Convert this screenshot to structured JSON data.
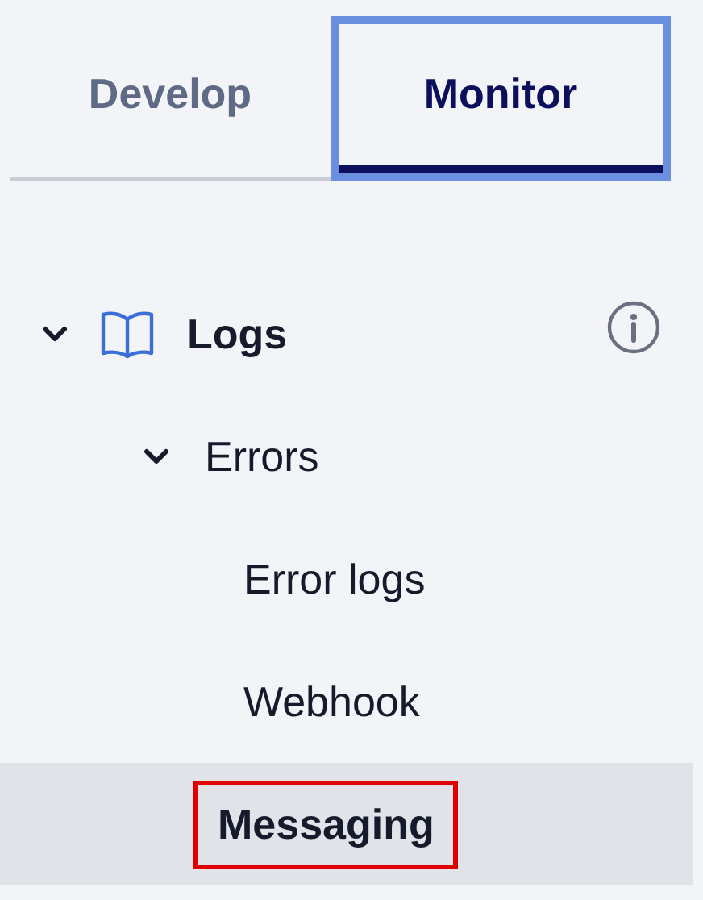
{
  "tabs": [
    {
      "label": "Develop",
      "selected": false,
      "focused": false
    },
    {
      "label": "Monitor",
      "selected": true,
      "focused": true
    }
  ],
  "tree": [
    {
      "label": "Logs",
      "kind": "section",
      "expanded": true,
      "selected": false,
      "children": [
        {
          "label": "Errors",
          "kind": "group",
          "expanded": true,
          "selected": false,
          "children": [
            {
              "label": "Error logs",
              "kind": "leaf",
              "selected": false,
              "highlighted": false
            },
            {
              "label": "Webhook",
              "kind": "leaf",
              "selected": false,
              "highlighted": false
            },
            {
              "label": "Messaging",
              "kind": "leaf",
              "selected": true,
              "highlighted": true
            }
          ]
        }
      ]
    }
  ]
}
